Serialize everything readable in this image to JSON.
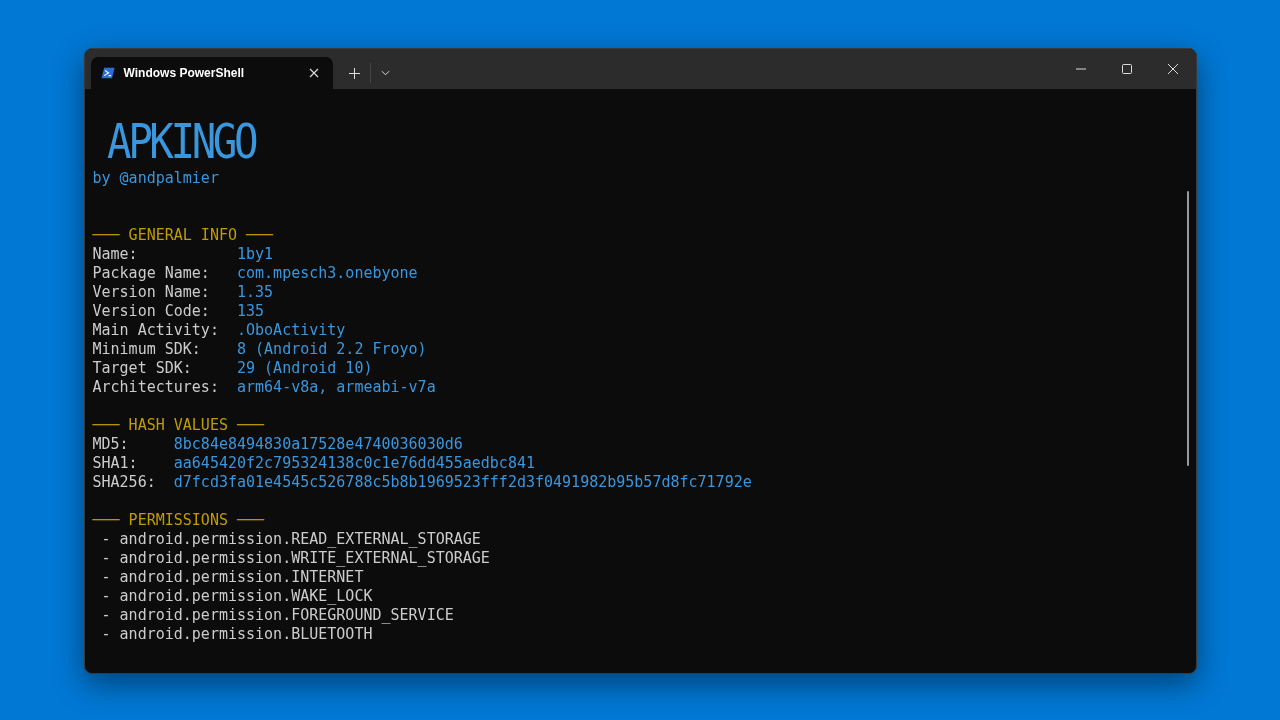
{
  "window": {
    "tab_title": "Windows PowerShell"
  },
  "terminal": {
    "logo": "APKINGO",
    "byline": "by @andpalmier",
    "sections": [
      {
        "heading": "─── GENERAL INFO ───",
        "kind": "fields",
        "rows": [
          {
            "label": "Name:",
            "value": "1by1"
          },
          {
            "label": "Package Name:",
            "value": "com.mpesch3.onebyone"
          },
          {
            "label": "Version Name:",
            "value": "1.35"
          },
          {
            "label": "Version Code:",
            "value": "135"
          },
          {
            "label": "Main Activity:",
            "value": ".OboActivity"
          },
          {
            "label": "Minimum SDK:",
            "value": "8 (Android 2.2 Froyo)"
          },
          {
            "label": "Target SDK:",
            "value": "29 (Android 10)"
          },
          {
            "label": "Architectures:",
            "value": "arm64-v8a, armeabi-v7a"
          }
        ]
      },
      {
        "heading": "─── HASH VALUES ───",
        "kind": "fields",
        "rows": [
          {
            "label": "MD5:",
            "value": "8bc84e8494830a17528e4740036030d6"
          },
          {
            "label": "SHA1:",
            "value": "aa645420f2c795324138c0c1e76dd455aedbc841"
          },
          {
            "label": "SHA256:",
            "value": "d7fcd3fa01e4545c526788c5b8b1969523fff2d3f0491982b95b57d8fc71792e"
          }
        ]
      },
      {
        "heading": "─── PERMISSIONS ───",
        "kind": "list",
        "items": [
          " - android.permission.READ_EXTERNAL_STORAGE",
          " - android.permission.WRITE_EXTERNAL_STORAGE",
          " - android.permission.INTERNET",
          " - android.permission.WAKE_LOCK",
          " - android.permission.FOREGROUND_SERVICE",
          " - android.permission.BLUETOOTH"
        ]
      }
    ]
  }
}
